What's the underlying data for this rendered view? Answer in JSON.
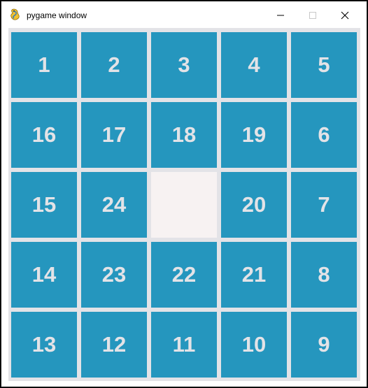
{
  "window": {
    "title": "pygame window",
    "controls": {
      "minimize_icon": "minimize-icon",
      "maximize_icon": "maximize-icon",
      "close_icon": "close-icon"
    }
  },
  "colors": {
    "tile": "#2596be",
    "empty_tile": "#f7f2f2",
    "grid_line": "#e3e3e7",
    "number_text": "#e3e3e7"
  },
  "board": {
    "rows": 5,
    "cols": 5,
    "tiles": [
      [
        "1",
        "2",
        "3",
        "4",
        "5"
      ],
      [
        "16",
        "17",
        "18",
        "19",
        "6"
      ],
      [
        "15",
        "24",
        "",
        "20",
        "7"
      ],
      [
        "14",
        "23",
        "22",
        "21",
        "8"
      ],
      [
        "13",
        "12",
        "11",
        "10",
        "9"
      ]
    ]
  }
}
